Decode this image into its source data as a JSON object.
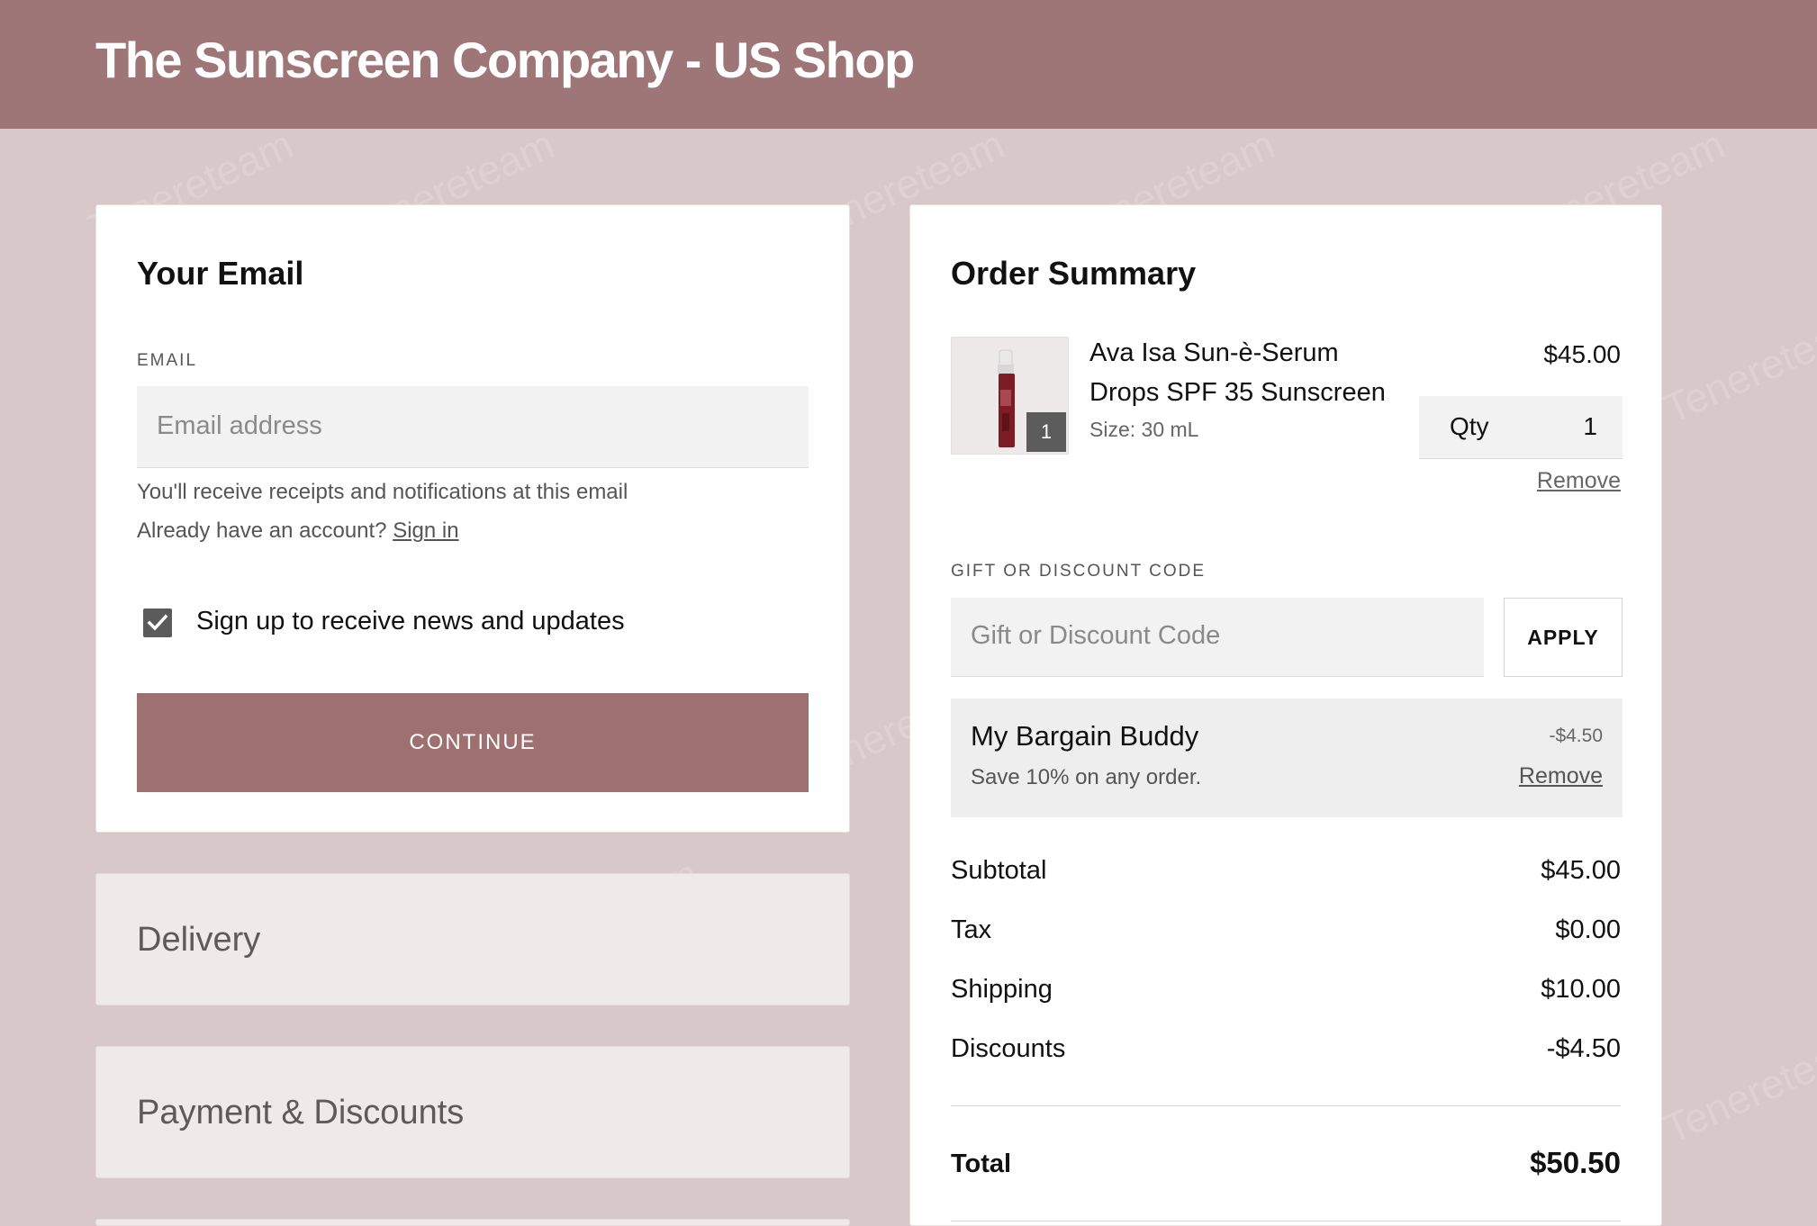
{
  "header": {
    "shop_title": "The Sunscreen Company - US Shop"
  },
  "email_section": {
    "title": "Your Email",
    "email_label": "EMAIL",
    "email_placeholder": "Email address",
    "helper_text": "You'll receive receipts and notifications at this email",
    "account_prompt": "Already have an account?",
    "sign_in_link": "Sign in",
    "newsletter_label": "Sign up to receive news and updates",
    "newsletter_checked": true,
    "continue_label": "CONTINUE"
  },
  "collapsed_sections": {
    "delivery": "Delivery",
    "payment": "Payment & Discounts"
  },
  "order_summary": {
    "title": "Order Summary",
    "item": {
      "name_line1": "Ava Isa Sun-è-Serum",
      "name_line2": "Drops SPF 35 Sunscreen",
      "size": "Size: 30 mL",
      "price": "$45.00",
      "qty_label": "Qty",
      "qty_value": "1",
      "thumb_badge": "1",
      "remove_label": "Remove"
    },
    "discount_code": {
      "label": "GIFT OR DISCOUNT CODE",
      "placeholder": "Gift or Discount Code",
      "apply_label": "APPLY"
    },
    "applied_discount": {
      "name": "My Bargain Buddy",
      "description": "Save 10% on any order.",
      "amount": "-$4.50",
      "remove_label": "Remove"
    },
    "totals": {
      "subtotal_label": "Subtotal",
      "subtotal_value": "$45.00",
      "tax_label": "Tax",
      "tax_value": "$0.00",
      "shipping_label": "Shipping",
      "shipping_value": "$10.00",
      "discounts_label": "Discounts",
      "discounts_value": "-$4.50",
      "total_label": "Total",
      "total_value": "$50.50"
    }
  },
  "watermark": {
    "text": "Tenereteam"
  },
  "colors": {
    "header_bg": "#9e7677",
    "page_bg": "#d9c8c9",
    "button_bg": "#9e7070",
    "checkbox_bg": "#5b5b5b"
  },
  "icons": {
    "checkbox": "checkmark-icon",
    "watermark_logo": "watermark-logo-icon",
    "product_thumb": "product-bottle-image"
  }
}
